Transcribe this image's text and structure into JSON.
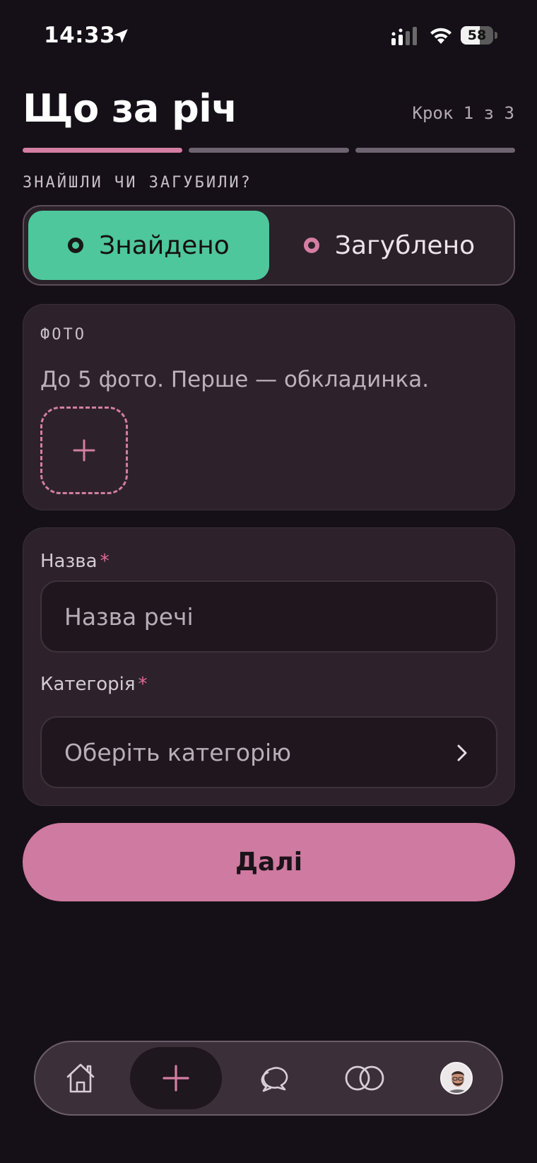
{
  "status_bar": {
    "time": "14:33",
    "battery_percent": "58",
    "battery_level": 0.58
  },
  "header": {
    "title": "Що за річ",
    "step": "Крок 1 з 3",
    "progress": {
      "current_step": 1,
      "total_steps": 3
    }
  },
  "type_section": {
    "label": "ЗНАЙШЛИ ЧИ ЗАГУБИЛИ?",
    "options": [
      {
        "label": "Знайдено",
        "selected": true
      },
      {
        "label": "Загублено",
        "selected": false
      }
    ]
  },
  "photo_card": {
    "label": "ФОТО",
    "hint": "До 5 фото. Перше — обкладинка."
  },
  "form": {
    "name_label": "Назва",
    "name_placeholder": "Назва речі",
    "category_label": "Категорія",
    "category_placeholder": "Оберіть категорію",
    "required_mark": "*"
  },
  "next_button": {
    "label": "Далі"
  },
  "tabbar": {
    "items": [
      {
        "icon": "home-icon"
      },
      {
        "icon": "plus-icon",
        "active": true
      },
      {
        "icon": "chat-icon"
      },
      {
        "icon": "match-icon"
      },
      {
        "icon": "avatar"
      }
    ]
  },
  "colors": {
    "background": "#151017",
    "accent_pink": "#d47ea3",
    "found_green": "#4ec79c",
    "card": "#2d222b"
  }
}
